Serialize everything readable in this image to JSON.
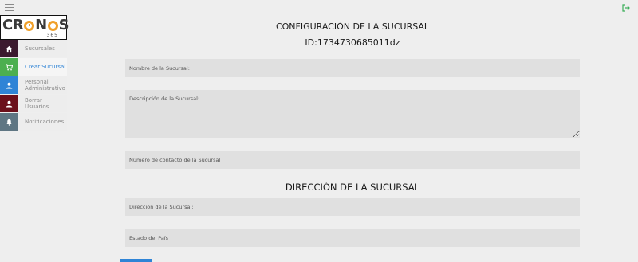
{
  "app": {
    "logo_text_left": "CR",
    "logo_text_right": "N",
    "logo_text_end": "S",
    "logo_sub": "365"
  },
  "sidebar": {
    "items": [
      {
        "label": "Sucursales",
        "icon": "home-icon",
        "color": "#3b1a2e"
      },
      {
        "label": "Crear Sucursal",
        "icon": "cart-icon",
        "color": "#4caf50"
      },
      {
        "label": "Personal Administrativo",
        "icon": "user-icon",
        "color": "#2f84d6"
      },
      {
        "label": "Borrar Usuarios",
        "icon": "user-icon",
        "color": "#6b0f1a"
      },
      {
        "label": "Notificaciones",
        "icon": "bell-icon",
        "color": "#5f7683"
      }
    ]
  },
  "form": {
    "title": "CONFIGURACIÓN DE LA SUCURSAL",
    "id_text": "ID:1734730685011dz",
    "nombre_placeholder": "Nombre de la Sucursal:",
    "descripcion_placeholder": "Descripción de la Sucursal:",
    "contacto_placeholder": "Número de contacto de la Sucursal",
    "address_section_title": "DIRECCIÓN DE LA SUCURSAL",
    "direccion_placeholder": "Dirección de la Sucursal:",
    "estado_placeholder": "Estado del País"
  },
  "colors": {
    "accent": "#2f84d6",
    "logout": "#3cae5a",
    "logo_ring": "#f0a02a"
  }
}
